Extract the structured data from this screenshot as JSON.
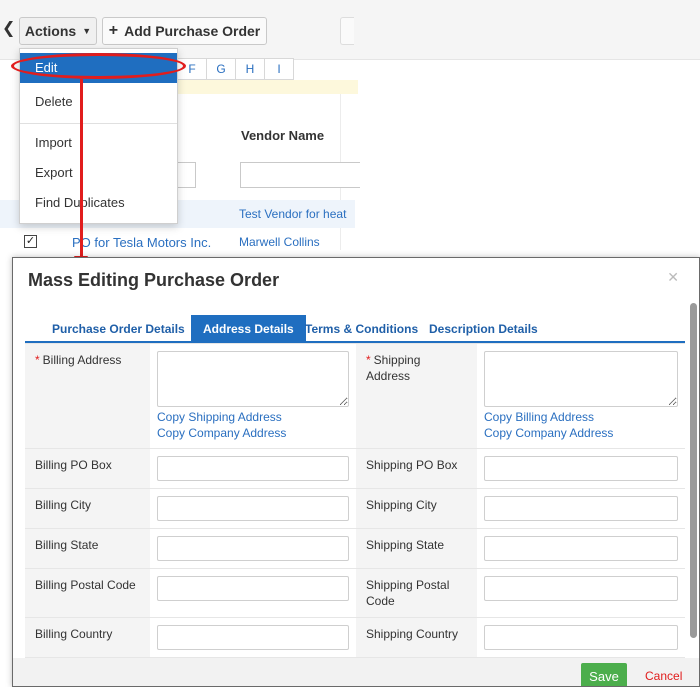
{
  "toolbar": {
    "back_icon": "chevron-left-icon",
    "actions_label": "Actions",
    "add_po_label": "Add Purchase Order"
  },
  "alpha_filter": [
    "F",
    "G",
    "H",
    "I"
  ],
  "list": {
    "column_header": "Vendor Name",
    "rows": [
      {
        "subject": "",
        "vendor": "Test Vendor for heat",
        "checked": false
      },
      {
        "subject": "PO for Tesla Motors Inc.",
        "vendor": "Marwell Collins",
        "checked": true
      }
    ]
  },
  "actions_menu": {
    "items": [
      "Edit",
      "Delete",
      "Import",
      "Export",
      "Find Duplicates"
    ],
    "active": "Edit"
  },
  "modal": {
    "title": "Mass Editing Purchase Order",
    "close_icon": "close-icon",
    "tabs": [
      "Purchase Order Details",
      "Address Details",
      "Terms & Conditions",
      "Description Details"
    ],
    "active_tab": "Address Details",
    "billing_address_label": "Billing Address",
    "shipping_address_label": "Shipping Address",
    "copy_shipping_address": "Copy Shipping Address",
    "copy_company_address": "Copy Company Address",
    "copy_billing_address": "Copy Billing Address",
    "billing_po_box": "Billing PO Box",
    "shipping_po_box": "Shipping PO Box",
    "billing_city": "Billing City",
    "shipping_city": "Shipping City",
    "billing_state": "Billing State",
    "shipping_state": "Shipping State",
    "billing_postal_code": "Billing Postal Code",
    "shipping_postal_code": "Shipping Postal Code",
    "billing_country": "Billing Country",
    "shipping_country": "Shipping Country",
    "save_label": "Save",
    "cancel_label": "Cancel"
  },
  "colors": {
    "accent": "#1f6ec0",
    "save": "#4cae4c",
    "annotation": "#e11d1d"
  }
}
